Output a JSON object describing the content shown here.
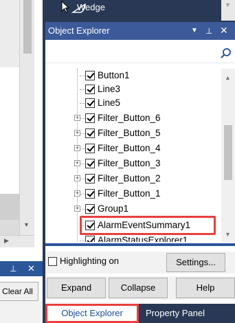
{
  "upper": {
    "item_label": "Wedge"
  },
  "object_explorer": {
    "title": "Object Explorer",
    "search": {
      "value": "",
      "placeholder": ""
    },
    "tree_items": [
      {
        "label": "Button1",
        "checked": true,
        "expandable": false
      },
      {
        "label": "Line3",
        "checked": true,
        "expandable": false
      },
      {
        "label": "Line5",
        "checked": true,
        "expandable": false
      },
      {
        "label": "Filter_Button_6",
        "checked": true,
        "expandable": true
      },
      {
        "label": "Filter_Button_5",
        "checked": true,
        "expandable": true
      },
      {
        "label": "Filter_Button_4",
        "checked": true,
        "expandable": true
      },
      {
        "label": "Filter_Button_3",
        "checked": true,
        "expandable": true
      },
      {
        "label": "Filter_Button_2",
        "checked": true,
        "expandable": true
      },
      {
        "label": "Filter_Button_1",
        "checked": true,
        "expandable": true
      },
      {
        "label": "Group1",
        "checked": true,
        "expandable": true
      },
      {
        "label": "AlarmEventSummary1",
        "checked": true,
        "expandable": false,
        "highlighted": true
      },
      {
        "label": "AlarmStatusExplorer1",
        "checked": true,
        "expandable": false
      }
    ],
    "highlighting": {
      "label": "Highlighting on",
      "checked": false
    },
    "settings_label": "Settings...",
    "buttons": {
      "expand": "Expand",
      "collapse": "Collapse",
      "help": "Help"
    }
  },
  "left_panel": {
    "clear_all_label": "Clear All"
  },
  "tabs": {
    "object_explorer": "Object Explorer",
    "property_panel": "Property Panel"
  },
  "colors": {
    "accent": "#3c5a99",
    "highlight_red": "#e8403c",
    "dock_background": "#293955"
  }
}
